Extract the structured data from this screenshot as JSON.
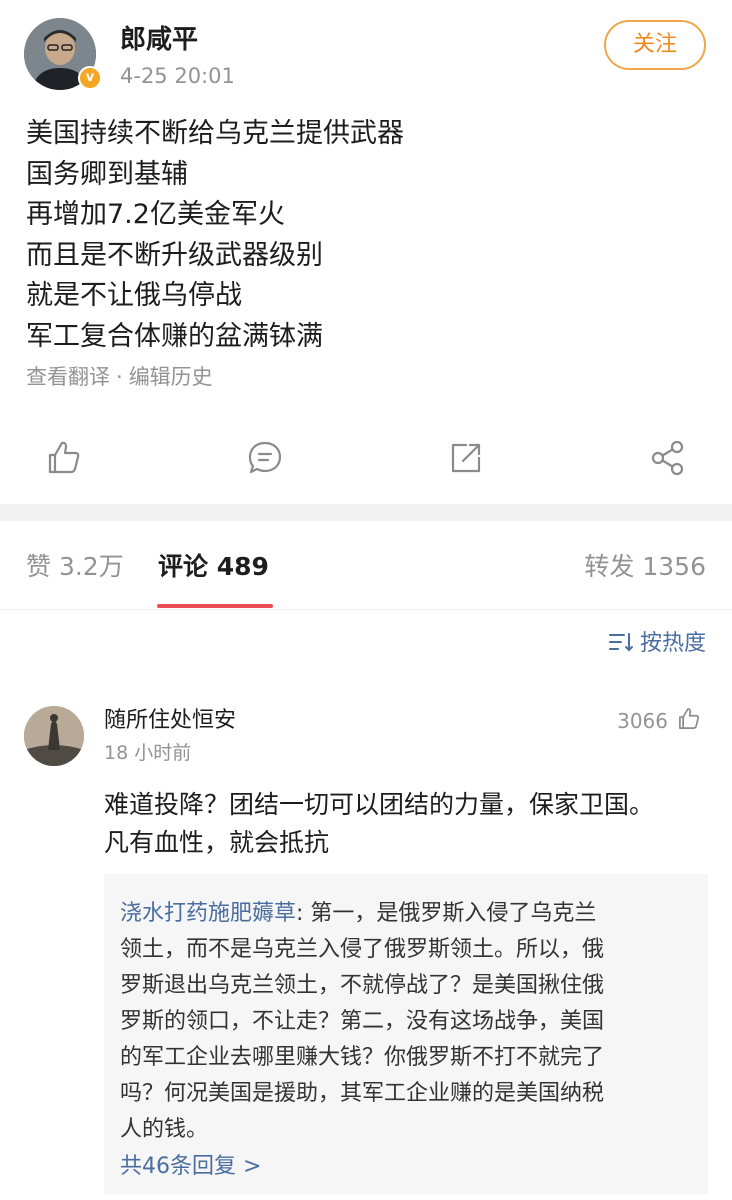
{
  "post": {
    "author": {
      "name": "郎咸平",
      "verified_badge": "v",
      "time": "4-25 20:01"
    },
    "follow_label": "关注",
    "lines": [
      "美国持续不断给乌克兰提供武器",
      "国务卿到基辅",
      "再增加7.2亿美金军火",
      "而且是不断升级武器级别",
      "就是不让俄乌停战",
      "军工复合体赚的盆满钵满"
    ],
    "meta": {
      "translate": "查看翻译",
      "separator": "·",
      "history": "编辑历史"
    },
    "actions": [
      "like-icon",
      "comment-icon",
      "repost-icon",
      "share-icon"
    ]
  },
  "tabs": {
    "likes": "赞 3.2万",
    "comments": "评论 489",
    "reposts": "转发 1356",
    "active_color": "#ec4b58"
  },
  "sort": {
    "icon": "sort-icon",
    "label": "按热度"
  },
  "comment": {
    "user": "随所住处恒安",
    "time": "18 小时前",
    "likes": "3066",
    "lines": [
      "难道投降？团结一切可以团结的力量，保家卫国。",
      "凡有血性，就会抵抗"
    ],
    "reply": {
      "user": "浇水打药施肥薅草",
      "first_line_rest": ": 第一，是俄罗斯入侵了乌克兰",
      "lines": [
        "领土，而不是乌克兰入侵了俄罗斯领土。所以，俄",
        "罗斯退出乌克兰领土，不就停战了？是美国揪住俄",
        "罗斯的领口，不让走？第二，没有这场战争，美国",
        "的军工企业去哪里赚大钱？你俄罗斯不打不就完了",
        "吗？何况美国是援助，其军工企业赚的是美国纳税",
        "人的钱。"
      ],
      "more": "共46条回复 >"
    }
  },
  "colors": {
    "follow": "#ef8a1f",
    "link": "#4a6ea0",
    "muted": "#939393"
  }
}
